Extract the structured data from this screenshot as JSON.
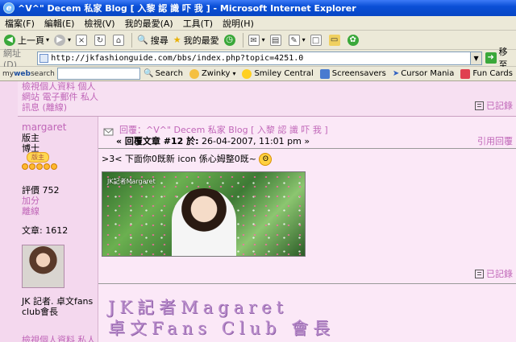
{
  "window": {
    "title": "^V^\" Decem 私家 Blog [ 入黎 認 識 吓 我 ] - Microsoft Internet Explorer"
  },
  "menu": [
    "檔案(F)",
    "編輯(E)",
    "檢視(V)",
    "我的最愛(A)",
    "工具(T)",
    "說明(H)"
  ],
  "toolbar": {
    "back": "上一頁",
    "search": "搜尋",
    "favorites": "我的最愛"
  },
  "address": {
    "label": "網址(D)",
    "url": "http://jkfashionguide.com/bbs/index.php?topic=4251.0",
    "go": "移至"
  },
  "websearch": {
    "logo_a": "my",
    "logo_b": "web",
    "logo_c": "search",
    "search": "Search",
    "zwinky": "Zwinky",
    "smiley": "Smiley Central",
    "screensavers": "Screensavers",
    "cursor": "Cursor Mania",
    "funcards": "Fun Cards"
  },
  "prev_post": {
    "profile_line1": "檢視個人資料 個人",
    "profile_line2": "網站 電子郵件 私人",
    "profile_line3": "訊息 (離線)",
    "record": "已記錄"
  },
  "post": {
    "username": "margaret",
    "role": "版主",
    "rank": "博士",
    "badge": "版主",
    "karma_label": "評價 752",
    "karma_add": "加分",
    "status": "離線",
    "posts": "文章: 1612",
    "bio_line1": "JK 記者. 卓文fans",
    "bio_line2": "club會長",
    "profile_line1": "檢視個人資料 私人",
    "title": "回覆：^V^\" Decem 私家 Blog [ 入黎 認 識 吓 我 ]",
    "meta_prefix": "« 回覆文章 #12 於:",
    "meta_date": "26-04-2007, 11:01 pm »",
    "quote": "引用回覆",
    "body": ">3< 下面你0既新 icon 係心姆整0既~",
    "photo_caption": "JK記者Margaret",
    "record": "已記錄",
    "signature_line1": "JK記者Magaret",
    "signature_line2": "卓文Fans Club 會長"
  }
}
